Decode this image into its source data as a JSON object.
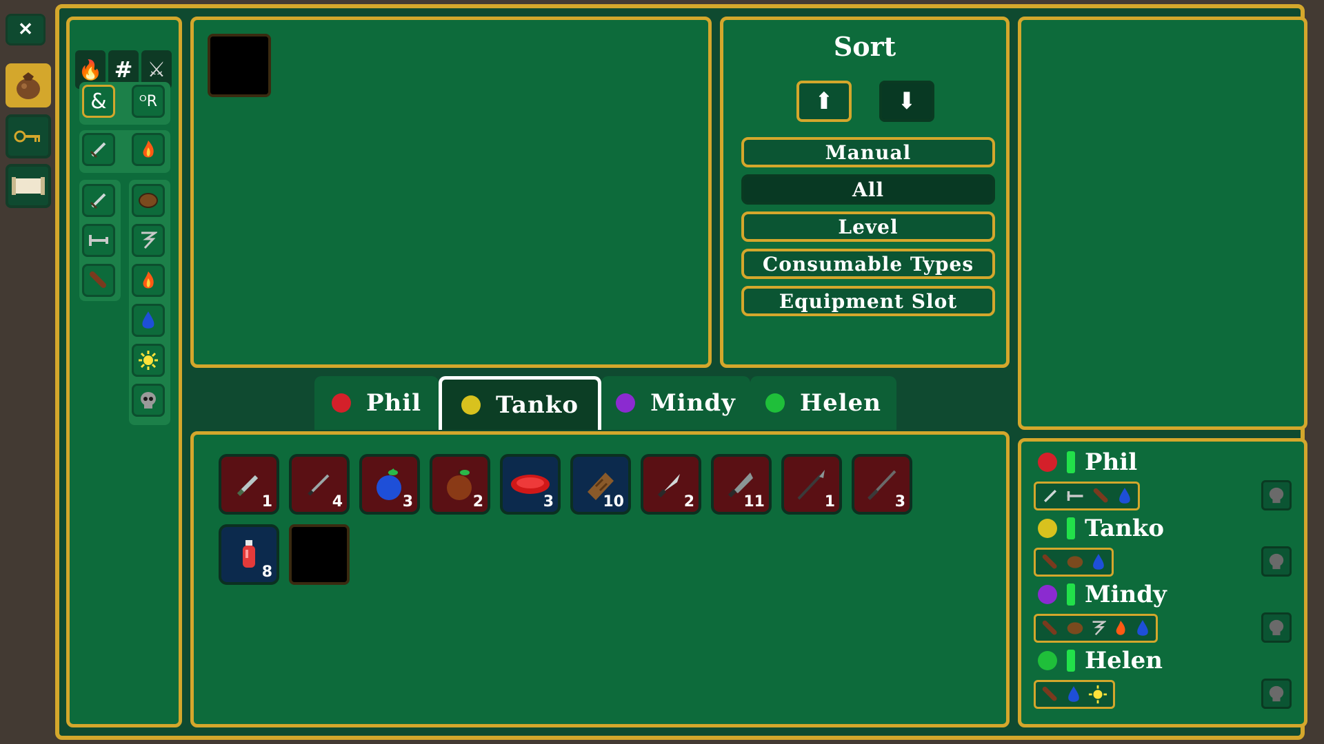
{
  "left_nav": {
    "items": [
      {
        "icon": "close-icon",
        "glyph": "✕",
        "active": false
      },
      {
        "icon": "bag-icon",
        "active": true
      },
      {
        "icon": "key-icon",
        "active": false
      },
      {
        "icon": "scroll-icon",
        "active": false
      }
    ]
  },
  "filter_tabs": [
    {
      "icon": "fire-icon",
      "glyph": "🔥"
    },
    {
      "icon": "hash-icon",
      "glyph": "#"
    },
    {
      "icon": "crossed-swords-icon",
      "glyph": "⚔"
    }
  ],
  "filter_logic": [
    {
      "icon": "and-icon",
      "glyph": "&"
    },
    {
      "icon": "or-icon",
      "glyph": "ᴼR"
    }
  ],
  "sort": {
    "title": "Sort",
    "up_glyph": "⬆",
    "down_glyph": "⬇",
    "options": [
      "Manual",
      "All",
      "Level",
      "Consumable Types",
      "Equipment Slot"
    ],
    "selected": "All"
  },
  "party_tabs": [
    {
      "name": "Phil",
      "color": "#d4202a"
    },
    {
      "name": "Tanko",
      "color": "#d8c21e"
    },
    {
      "name": "Mindy",
      "color": "#8b2bd0"
    },
    {
      "name": "Helen",
      "color": "#1fbf3a"
    }
  ],
  "selected_tab": "Tanko",
  "inventory": [
    {
      "icon": "dagger-icon",
      "count": "1",
      "bg": "red"
    },
    {
      "icon": "knife-icon",
      "count": "4",
      "bg": "red"
    },
    {
      "icon": "blueberry-icon",
      "count": "3",
      "bg": "red"
    },
    {
      "icon": "apple-icon",
      "count": "2",
      "bg": "red"
    },
    {
      "icon": "meat-icon",
      "count": "3",
      "bg": "blue"
    },
    {
      "icon": "bread-icon",
      "count": "10",
      "bg": "blue"
    },
    {
      "icon": "blade-icon",
      "count": "2",
      "bg": "red"
    },
    {
      "icon": "cleaver-icon",
      "count": "11",
      "bg": "red"
    },
    {
      "icon": "spear-icon",
      "count": "1",
      "bg": "red"
    },
    {
      "icon": "lance-icon",
      "count": "3",
      "bg": "red"
    },
    {
      "icon": "potion-icon",
      "count": "8",
      "bg": "blue"
    }
  ],
  "party": [
    {
      "name": "Phil",
      "color": "#d4202a",
      "icons": [
        "sword-icon",
        "hammer-icon",
        "club-icon",
        "water-icon"
      ]
    },
    {
      "name": "Tanko",
      "color": "#d8c21e",
      "icons": [
        "club-icon",
        "shield-icon",
        "water-icon"
      ]
    },
    {
      "name": "Mindy",
      "color": "#8b2bd0",
      "icons": [
        "club-icon",
        "shield-icon",
        "tornado-icon",
        "fire-icon",
        "water-icon"
      ]
    },
    {
      "name": "Helen",
      "color": "#1fbf3a",
      "icons": [
        "club-icon",
        "water-icon",
        "sun-icon"
      ]
    }
  ],
  "colors": {
    "gold": "#d4a72c",
    "panel": "#0d6b3b",
    "dark": "#0f4a30"
  }
}
